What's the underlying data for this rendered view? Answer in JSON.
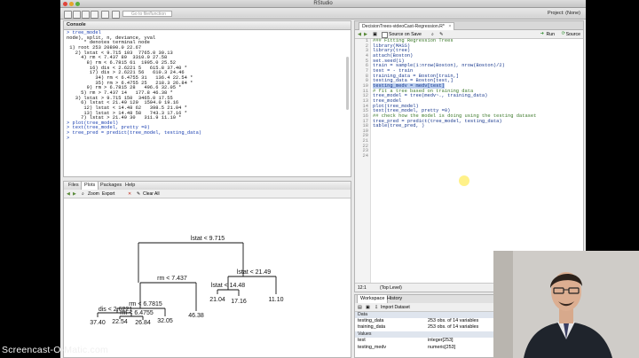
{
  "window": {
    "title": "RStudio",
    "search_placeholder": "Go to file/function",
    "project_label": "Project: (None)"
  },
  "console": {
    "title": "Console",
    "lines": [
      "> tree_model",
      "node), split, n, deviance, yval",
      "      * denotes terminal node",
      "",
      " 1) root 253 20890.0 22.67",
      "   2) lstat < 9.715 103  7765.0 30.13",
      "     4) rm < 7.437 89  3310.0 27.58",
      "       8) rm < 6.7815 61  1995.0 25.52",
      "        16) dis < 2.6221 5   615.8 37.40 *",
      "        17) dis > 2.6221 56   610.3 24.46",
      "          34) rm < 6.4755 31   136.4 22.54 *",
      "          35) rm > 6.4755 25   218.3 26.84 *",
      "       9) rm > 6.7815 28   496.6 32.05 *",
      "     5) rm > 7.437 14   177.8 46.38 *",
      "   3) lstat > 9.715 150  3465.0 17.55",
      "     6) lstat < 21.49 120  1594.0 19.16",
      "      12) lstat < 14.48 62   398.5 21.04 *",
      "      13) lstat > 14.48 58   743.3 17.16 *",
      "     7) lstat > 21.49 30   311.9 11.10 *",
      "> plot(tree_model)",
      "> text(tree_model, pretty =0)",
      "> tree_pred = predict(tree_model, testing_data)",
      "> "
    ]
  },
  "plots_pane": {
    "tabs": [
      "Files",
      "Plots",
      "Packages",
      "Help"
    ],
    "zoom_label": "Zoom",
    "export_label": "Export",
    "clear_all_label": "Clear All"
  },
  "tree_plot": {
    "splits": {
      "root": "lstat < 9.715",
      "left": "rm < 7.437",
      "right": "lstat < 21.49",
      "left_left": "rm < 6.7815",
      "right_left": "lstat < 14.48",
      "lll": "dis < 2.6221",
      "lllr": "rm < 6.4755"
    },
    "leaves": [
      "37.40",
      "22.54",
      "26.84",
      "32.05",
      "46.38",
      "21.04",
      "17.16",
      "11.10"
    ]
  },
  "editor": {
    "tab_label": "DecisionTrees-videoCast-Regression.R*",
    "source_on_save": "Source on Save",
    "run_label": "Run",
    "source_label": "Source",
    "lines": [
      "### Fitting Regression Trees",
      "",
      "library(MASS)",
      "library(tree)",
      "attach(Boston)",
      "set.seed(1)",
      "train = sample(1:nrow(Boston), nrow(Boston)/2)",
      "test = - train",
      "",
      "training_data = Boston[train,]",
      "testing_data = Boston[test,]",
      "testing_medv = medv[test]",
      "",
      "# fit a tree based on training data",
      "",
      "tree_model = tree(medv~., training_data)",
      "tree_model",
      "plot(tree_model)",
      "text(tree_model, pretty =0)",
      "",
      "## check how the model is doing using the testing dataset",
      "",
      "tree_pred = predict(tree_model, testing_data)",
      "table(tree_pred, )"
    ],
    "status_pos": "12:1",
    "status_scope": "(Top Level)"
  },
  "workspace": {
    "tabs": [
      "Workspace",
      "History"
    ],
    "import_label": "Import Dataset",
    "data_header": "Data",
    "values_header": "Values",
    "data": [
      {
        "name": "testing_data",
        "value": "253 obs. of 14 variables"
      },
      {
        "name": "training_data",
        "value": "253 obs. of 14 variables"
      }
    ],
    "values": [
      {
        "name": "test",
        "value": "integer[253]"
      },
      {
        "name": "testing_medv",
        "value": "numeric[253]"
      }
    ]
  },
  "watermark": "Screencast-O-Matic.com"
}
